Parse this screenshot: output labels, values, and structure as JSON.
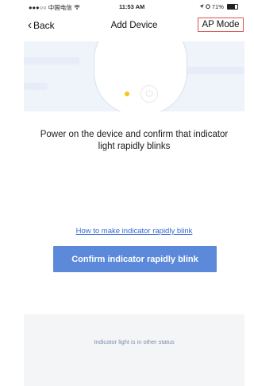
{
  "status_bar": {
    "carrier": "●●●○○ 中国电信",
    "wifi_icon": "wifi-icon",
    "time": "11:53 AM",
    "location_icon": "location-arrow-icon",
    "alarm_icon": "alarm-icon",
    "battery_percent": "71%",
    "battery_level": 0.71
  },
  "nav": {
    "back_label": "Back",
    "title": "Add Device",
    "ap_mode_label": "AP Mode",
    "ap_mode_border_color": "#d9534f"
  },
  "illustration": {
    "led_color": "#f5c518",
    "power_icon": "power-icon"
  },
  "instruction": "Power on the device and confirm that indicator light rapidly blinks",
  "help_link": "How to make indicator rapidly blink",
  "confirm_button": "Confirm indicator rapidly blink",
  "other_status": "Indicator light is in other status",
  "colors": {
    "accent": "#5c89da",
    "link": "#3468d3",
    "hero_bg": "#eff3fa"
  }
}
